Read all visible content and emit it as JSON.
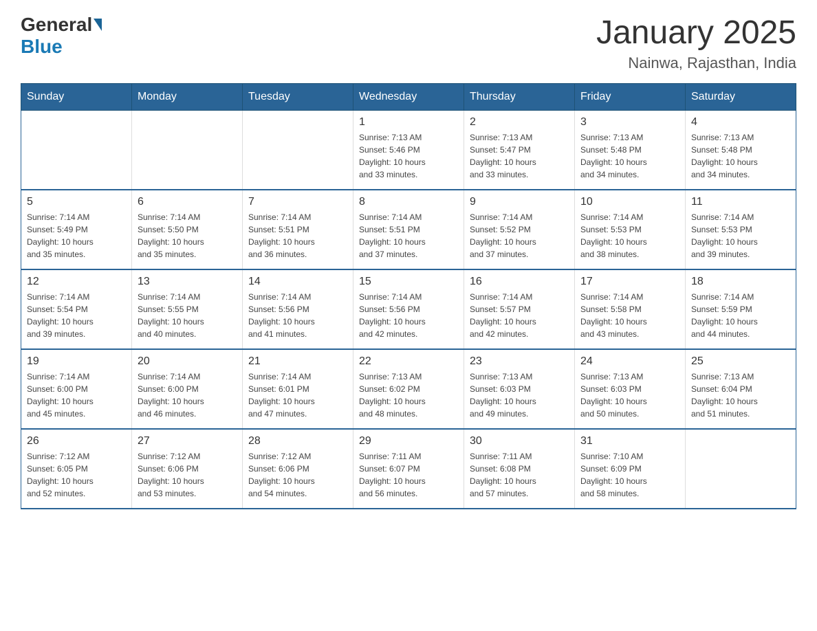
{
  "logo": {
    "general": "General",
    "blue": "Blue"
  },
  "title": "January 2025",
  "subtitle": "Nainwa, Rajasthan, India",
  "days_header": [
    "Sunday",
    "Monday",
    "Tuesday",
    "Wednesday",
    "Thursday",
    "Friday",
    "Saturday"
  ],
  "weeks": [
    [
      {
        "day": "",
        "info": ""
      },
      {
        "day": "",
        "info": ""
      },
      {
        "day": "",
        "info": ""
      },
      {
        "day": "1",
        "info": "Sunrise: 7:13 AM\nSunset: 5:46 PM\nDaylight: 10 hours\nand 33 minutes."
      },
      {
        "day": "2",
        "info": "Sunrise: 7:13 AM\nSunset: 5:47 PM\nDaylight: 10 hours\nand 33 minutes."
      },
      {
        "day": "3",
        "info": "Sunrise: 7:13 AM\nSunset: 5:48 PM\nDaylight: 10 hours\nand 34 minutes."
      },
      {
        "day": "4",
        "info": "Sunrise: 7:13 AM\nSunset: 5:48 PM\nDaylight: 10 hours\nand 34 minutes."
      }
    ],
    [
      {
        "day": "5",
        "info": "Sunrise: 7:14 AM\nSunset: 5:49 PM\nDaylight: 10 hours\nand 35 minutes."
      },
      {
        "day": "6",
        "info": "Sunrise: 7:14 AM\nSunset: 5:50 PM\nDaylight: 10 hours\nand 35 minutes."
      },
      {
        "day": "7",
        "info": "Sunrise: 7:14 AM\nSunset: 5:51 PM\nDaylight: 10 hours\nand 36 minutes."
      },
      {
        "day": "8",
        "info": "Sunrise: 7:14 AM\nSunset: 5:51 PM\nDaylight: 10 hours\nand 37 minutes."
      },
      {
        "day": "9",
        "info": "Sunrise: 7:14 AM\nSunset: 5:52 PM\nDaylight: 10 hours\nand 37 minutes."
      },
      {
        "day": "10",
        "info": "Sunrise: 7:14 AM\nSunset: 5:53 PM\nDaylight: 10 hours\nand 38 minutes."
      },
      {
        "day": "11",
        "info": "Sunrise: 7:14 AM\nSunset: 5:53 PM\nDaylight: 10 hours\nand 39 minutes."
      }
    ],
    [
      {
        "day": "12",
        "info": "Sunrise: 7:14 AM\nSunset: 5:54 PM\nDaylight: 10 hours\nand 39 minutes."
      },
      {
        "day": "13",
        "info": "Sunrise: 7:14 AM\nSunset: 5:55 PM\nDaylight: 10 hours\nand 40 minutes."
      },
      {
        "day": "14",
        "info": "Sunrise: 7:14 AM\nSunset: 5:56 PM\nDaylight: 10 hours\nand 41 minutes."
      },
      {
        "day": "15",
        "info": "Sunrise: 7:14 AM\nSunset: 5:56 PM\nDaylight: 10 hours\nand 42 minutes."
      },
      {
        "day": "16",
        "info": "Sunrise: 7:14 AM\nSunset: 5:57 PM\nDaylight: 10 hours\nand 42 minutes."
      },
      {
        "day": "17",
        "info": "Sunrise: 7:14 AM\nSunset: 5:58 PM\nDaylight: 10 hours\nand 43 minutes."
      },
      {
        "day": "18",
        "info": "Sunrise: 7:14 AM\nSunset: 5:59 PM\nDaylight: 10 hours\nand 44 minutes."
      }
    ],
    [
      {
        "day": "19",
        "info": "Sunrise: 7:14 AM\nSunset: 6:00 PM\nDaylight: 10 hours\nand 45 minutes."
      },
      {
        "day": "20",
        "info": "Sunrise: 7:14 AM\nSunset: 6:00 PM\nDaylight: 10 hours\nand 46 minutes."
      },
      {
        "day": "21",
        "info": "Sunrise: 7:14 AM\nSunset: 6:01 PM\nDaylight: 10 hours\nand 47 minutes."
      },
      {
        "day": "22",
        "info": "Sunrise: 7:13 AM\nSunset: 6:02 PM\nDaylight: 10 hours\nand 48 minutes."
      },
      {
        "day": "23",
        "info": "Sunrise: 7:13 AM\nSunset: 6:03 PM\nDaylight: 10 hours\nand 49 minutes."
      },
      {
        "day": "24",
        "info": "Sunrise: 7:13 AM\nSunset: 6:03 PM\nDaylight: 10 hours\nand 50 minutes."
      },
      {
        "day": "25",
        "info": "Sunrise: 7:13 AM\nSunset: 6:04 PM\nDaylight: 10 hours\nand 51 minutes."
      }
    ],
    [
      {
        "day": "26",
        "info": "Sunrise: 7:12 AM\nSunset: 6:05 PM\nDaylight: 10 hours\nand 52 minutes."
      },
      {
        "day": "27",
        "info": "Sunrise: 7:12 AM\nSunset: 6:06 PM\nDaylight: 10 hours\nand 53 minutes."
      },
      {
        "day": "28",
        "info": "Sunrise: 7:12 AM\nSunset: 6:06 PM\nDaylight: 10 hours\nand 54 minutes."
      },
      {
        "day": "29",
        "info": "Sunrise: 7:11 AM\nSunset: 6:07 PM\nDaylight: 10 hours\nand 56 minutes."
      },
      {
        "day": "30",
        "info": "Sunrise: 7:11 AM\nSunset: 6:08 PM\nDaylight: 10 hours\nand 57 minutes."
      },
      {
        "day": "31",
        "info": "Sunrise: 7:10 AM\nSunset: 6:09 PM\nDaylight: 10 hours\nand 58 minutes."
      },
      {
        "day": "",
        "info": ""
      }
    ]
  ]
}
